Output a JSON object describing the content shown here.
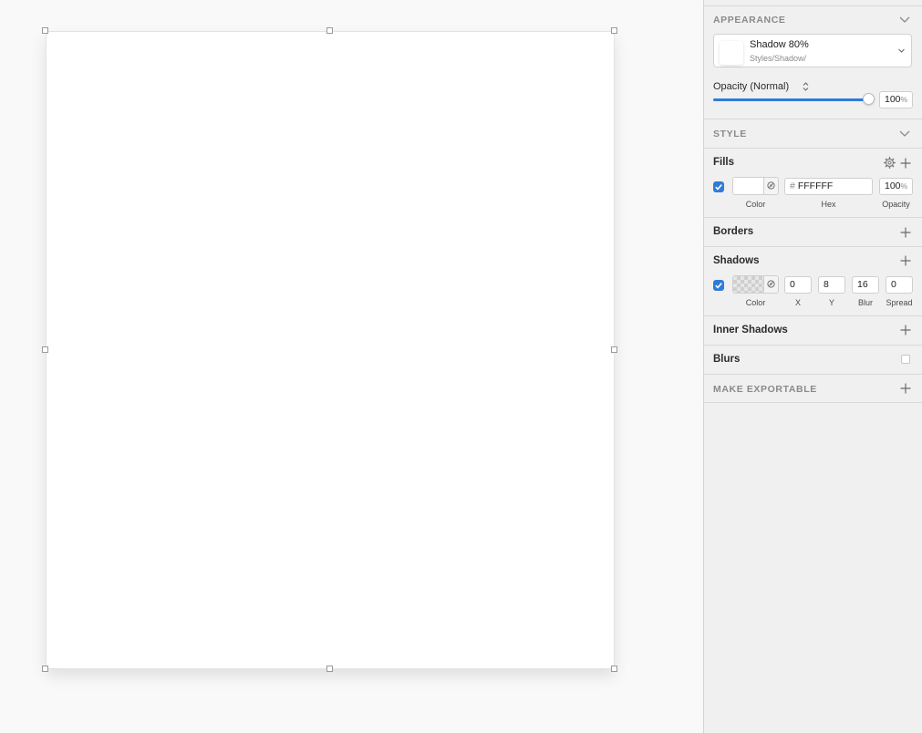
{
  "inspector": {
    "appearance": {
      "title": "APPEARANCE",
      "style_name": "Shadow 80%",
      "style_path": "Styles/Shadow/",
      "opacity_label": "Opacity (Normal)",
      "opacity_value": "100",
      "opacity_unit": "%",
      "opacity_fraction": 1.0
    },
    "style": {
      "title": "STYLE"
    },
    "fills": {
      "title": "Fills",
      "enabled": true,
      "hex_prefix": "#",
      "hex": "FFFFFF",
      "opacity": "100",
      "opacity_unit": "%",
      "label_color": "Color",
      "label_hex": "Hex",
      "label_opacity": "Opacity",
      "color": "#FFFFFF"
    },
    "borders": {
      "title": "Borders"
    },
    "shadows": {
      "title": "Shadows",
      "enabled": true,
      "x": "0",
      "y": "8",
      "blur": "16",
      "spread": "0",
      "label_color": "Color",
      "label_x": "X",
      "label_y": "Y",
      "label_blur": "Blur",
      "label_spread": "Spread"
    },
    "inner_shadows": {
      "title": "Inner Shadows"
    },
    "blurs": {
      "title": "Blurs"
    },
    "export": {
      "title": "MAKE EXPORTABLE"
    }
  },
  "colors": {
    "accent": "#2F7BD8",
    "panel_bg": "#F0F0F0",
    "canvas_bg": "#F9F9F9"
  }
}
